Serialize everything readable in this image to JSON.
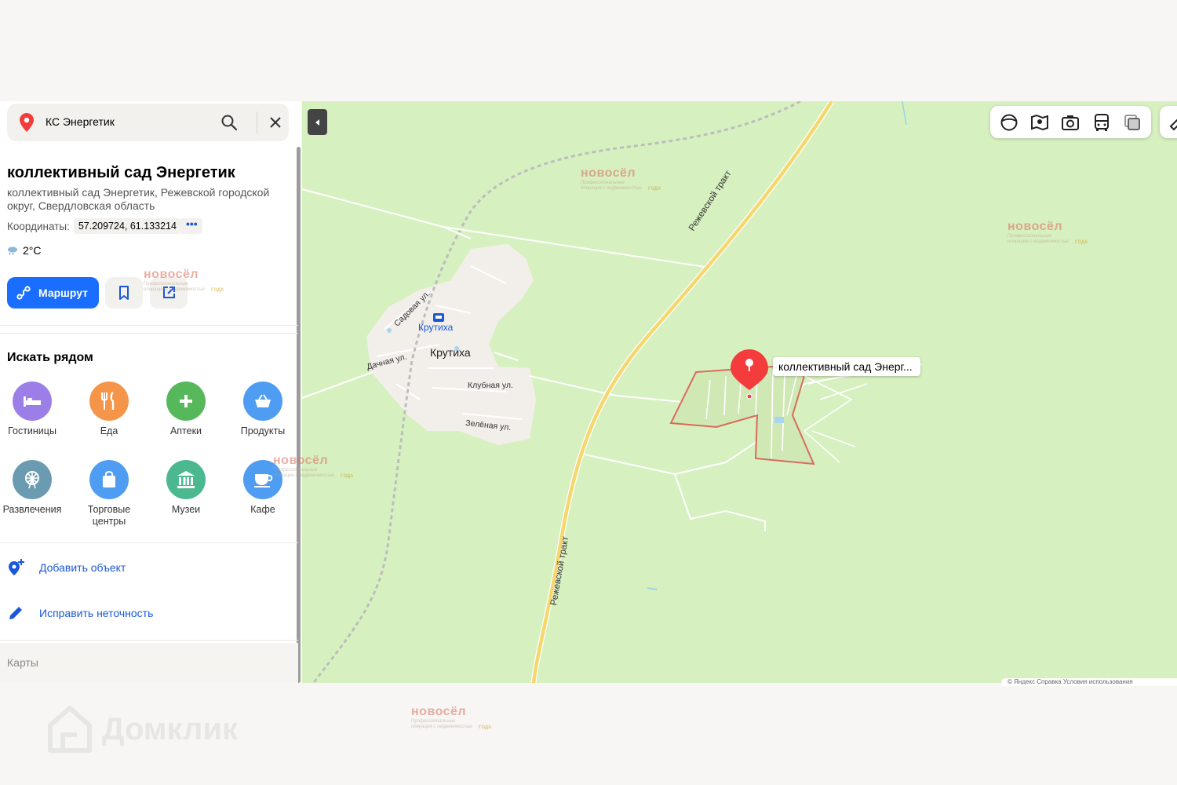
{
  "search": {
    "query": "КС Энергетик"
  },
  "place": {
    "title": "коллективный сад Энергетик",
    "address": "коллективный сад Энергетик, Режевской городской округ, Свердловская область",
    "coords_label": "Координаты:",
    "coords_value": "57.209724, 61.133214",
    "coords_more": "•••",
    "weather": "2°C"
  },
  "actions": {
    "route_label": "Маршрут"
  },
  "nearby": {
    "title": "Искать рядом",
    "categories": [
      {
        "label": "Гостиницы",
        "icon": "bed-icon",
        "color": "#9c7ee8"
      },
      {
        "label": "Еда",
        "icon": "fork-knife-icon",
        "color": "#f5954a"
      },
      {
        "label": "Аптеки",
        "icon": "plus-icon",
        "color": "#56b85a"
      },
      {
        "label": "Продукты",
        "icon": "basket-icon",
        "color": "#4f9df2"
      },
      {
        "label": "Развлечения",
        "icon": "ferris-wheel-icon",
        "color": "#6b9bb0"
      },
      {
        "label": "Торговые центры",
        "icon": "shopping-bag-icon",
        "color": "#4f9df2"
      },
      {
        "label": "Музеи",
        "icon": "museum-icon",
        "color": "#4cb890"
      },
      {
        "label": "Кафе",
        "icon": "cup-icon",
        "color": "#4f9df2"
      }
    ]
  },
  "links": {
    "add_object": "Добавить объект",
    "fix_error": "Исправить неточность"
  },
  "footer": {
    "label": "Карты"
  },
  "map": {
    "poi_callout": "коллективный сад Энерг...",
    "village_label": "Крутиха",
    "station_label": "Крутиха",
    "road_label_1": "Режевской тракт",
    "road_label_2": "Режевской тракт",
    "street_1": "Садовая ул.",
    "street_2": "Дачная ул.",
    "street_3": "Клубная ул.",
    "street_4": "Зелёная ул.",
    "copyright": "© Яндекс  Справка  Условия использования"
  },
  "watermark": {
    "brand": "новосёл",
    "sub": "Профессиональные операции с недвижимостью",
    "badge": "ГОДА"
  },
  "domclick": {
    "brand": "Домклик"
  },
  "colors": {
    "accent": "#196dff",
    "link": "#1a57d9",
    "map_bg": "#d7f0c0",
    "pin_red": "#f43c3c",
    "road": "#f5d76e"
  }
}
